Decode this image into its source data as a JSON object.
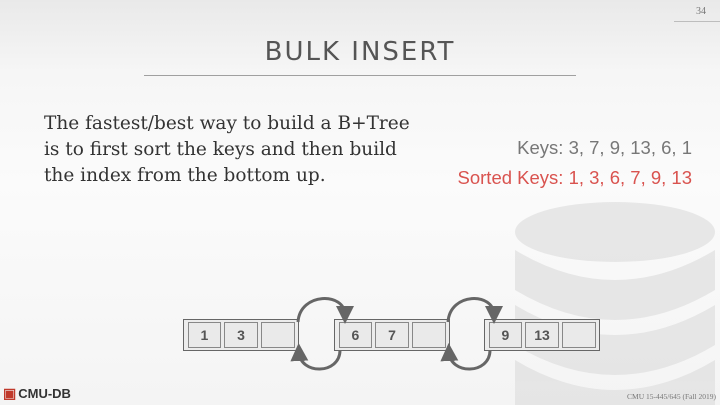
{
  "slide": {
    "page_number": "34",
    "title": "BULK INSERT",
    "body_text": "The fastest/best way to build a B+Tree is to first sort the keys and then build the index from the bottom up.",
    "keys_text": "Keys: 3, 7, 9, 13, 6, 1",
    "sorted_keys_text": "Sorted Keys: 1, 3, 6, 7, 9, 13"
  },
  "leaf_nodes": [
    {
      "slots": [
        "1",
        "3",
        ""
      ]
    },
    {
      "slots": [
        "6",
        "7",
        ""
      ]
    },
    {
      "slots": [
        "9",
        "13",
        ""
      ]
    }
  ],
  "footer": {
    "logo_text": "CMU-DB",
    "course_text": "CMU 15-445/645 (Fall 2019)"
  },
  "colors": {
    "accent_red": "#d9534f",
    "text_gray": "#777777"
  }
}
